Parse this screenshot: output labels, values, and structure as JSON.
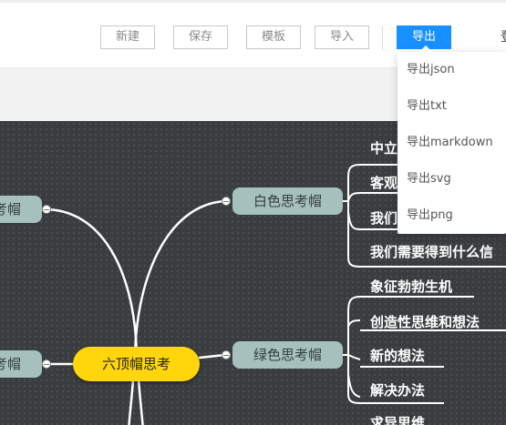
{
  "toolbar": {
    "new_label": "新建",
    "save_label": "保存",
    "template_label": "模板",
    "import_label": "导入",
    "export_label": "导出",
    "cut_text": "登"
  },
  "export_menu": {
    "items": [
      {
        "label": "导出json"
      },
      {
        "label": "导出txt"
      },
      {
        "label": "导出markdown"
      },
      {
        "label": "导出svg"
      },
      {
        "label": "导出png"
      }
    ]
  },
  "mindmap": {
    "root": "六顶帽思考",
    "left_nodes": [
      "考帽",
      "考帽"
    ],
    "branches": [
      {
        "label": "白色思考帽",
        "children": [
          "中立",
          "客观",
          "我们",
          "我们需要得到什么信"
        ]
      },
      {
        "label": "绿色思考帽",
        "children": [
          "象征勃勃生机",
          "创造性思维和想法",
          "新的想法",
          "解决办法",
          "求异思维"
        ]
      }
    ]
  },
  "colors": {
    "accent": "#1890ff",
    "canvas_bg": "#3a3d3f",
    "root_fill": "#ffd60a",
    "branch_fill": "#a6c1bd",
    "line": "#ffffff"
  }
}
